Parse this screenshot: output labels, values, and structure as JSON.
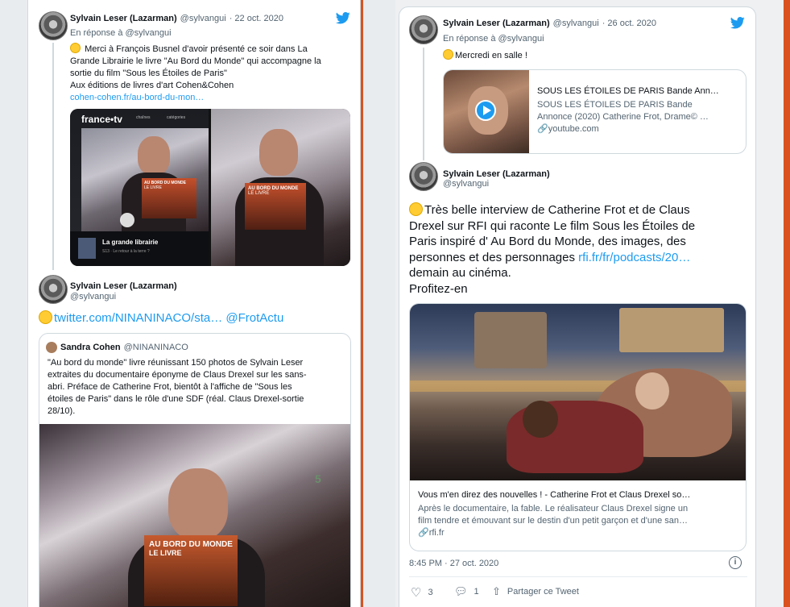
{
  "colors": {
    "background": "#d9521f",
    "link": "#1d9bf0",
    "text": "#0f1419",
    "muted": "#536471"
  },
  "left": {
    "tweet1": {
      "name": "Sylvain Leser (Lazarman)",
      "handle": "@sylvangui",
      "date": "· 22 oct. 2020",
      "reply_to": "En réponse à @sylvangui",
      "text_lines": [
        "Merci à François Busnel d'avoir présenté ce soir dans La",
        "Grande Librairie  le livre \"Au Bord du Monde\" qui accompagne la",
        "sortie du film \"Sous les Étoiles de Paris\"",
        "Aux éditions de livres d'art Cohen&Cohen"
      ],
      "link": "cohen-cohen.fr/au-bord-du-mon…",
      "media": {
        "brand": "france•tv",
        "tabs": [
          "chaînes",
          "catégories"
        ],
        "book_title": "AU BORD DU MONDE",
        "book_sub": "LE LIVRE",
        "show_title": "La grande librairie",
        "show_sub": "S13 · Le retour à la terre ?"
      }
    },
    "tweet2": {
      "name": "Sylvain Leser (Lazarman)",
      "handle": "@sylvangui",
      "link1": "twitter.com/NINANINACO/sta…",
      "link2": "@FrotActu",
      "quote": {
        "name": "Sandra Cohen",
        "handle": "@NINANINACO",
        "text_lines": [
          "\"Au bord du monde\" livre réunissant 150 photos de Sylvain Leser",
          "extraites du documentaire éponyme de Claus Drexel sur les sans-",
          "abri. Préface de Catherine Frot, bientôt à l'affiche de \"Sous les",
          "étoiles de Paris\" dans le rôle d'une SDF (réal. Claus Drexel-sortie",
          "28/10)."
        ],
        "channel": "5",
        "book_title": "AU BORD DU MONDE",
        "book_sub": "LE LIVRE"
      }
    }
  },
  "right": {
    "tweet1": {
      "name": "Sylvain Leser (Lazarman)",
      "handle": "@sylvangui",
      "date": "· 26 oct. 2020",
      "reply_to": "En réponse à @sylvangui",
      "text": "Mercredi en salle !",
      "card": {
        "title": "SOUS LES ÉTOILES DE PARIS Bande Ann…",
        "desc1": "SOUS LES ÉTOILES DE PARIS Bande",
        "desc2": "Annonce (2020) Catherine Frot, Drame© …",
        "domain": "youtube.com"
      }
    },
    "tweet2": {
      "name": "Sylvain Leser (Lazarman)",
      "handle": "@sylvangui",
      "text_lines": [
        "Très belle interview de Catherine Frot et de Claus",
        "Drexel sur RFI qui raconte Le film Sous les Étoiles de",
        "Paris inspiré d' Au Bord du Monde, des images, des"
      ],
      "line4_text": "personnes et des personnages ",
      "line4_link": "rfi.fr/fr/podcasts/20…",
      "line5": "demain au cinéma.",
      "line6": "Profitez-en",
      "card": {
        "title": "Vous m'en direz des nouvelles ! - Catherine Frot et Claus Drexel so…",
        "desc1": "Après le documentaire, la fable. Le réalisateur Claus Drexel signe un",
        "desc2": "film tendre et émouvant sur le destin d'un petit garçon et d'une san…",
        "domain": "rfi.fr"
      },
      "timestamp": "8:45 PM · 27 oct. 2020",
      "actions": {
        "likes": "3",
        "replies": "1",
        "share": "Partager ce Tweet"
      }
    }
  }
}
